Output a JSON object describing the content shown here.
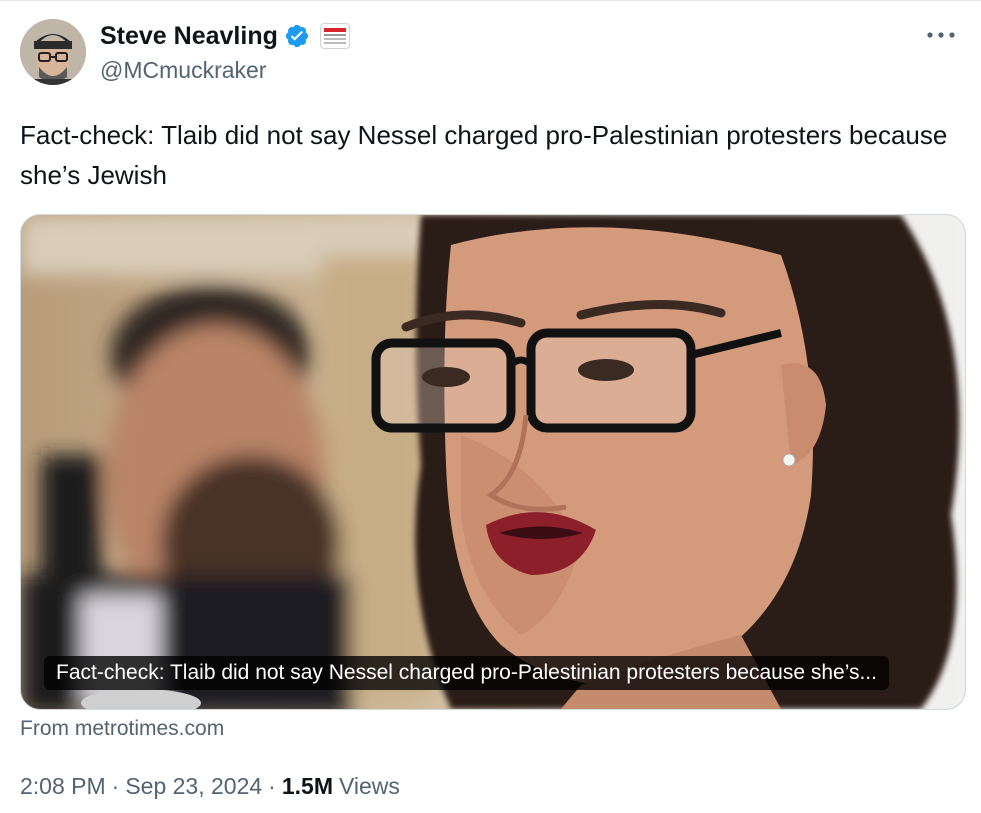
{
  "author": {
    "display_name": "Steve Neavling",
    "handle": "@MCmuckraker",
    "affiliate_badge_text": "METRO TIMES"
  },
  "tweet": {
    "text": "Fact-check: Tlaib did not say Nessel charged pro-Palestinian protesters because she’s Jewish"
  },
  "card": {
    "caption": "Fact-check: Tlaib did not say Nessel charged pro-Palestinian protesters because she’s...",
    "source": "From metrotimes.com"
  },
  "meta": {
    "time": "2:08 PM",
    "date": "Sep 23, 2024",
    "separator": "·",
    "views_count": "1.5M",
    "views_label": "Views"
  },
  "icons": {
    "verified": "verified-badge-icon",
    "more": "more-options-icon"
  },
  "colors": {
    "verified_blue": "#1d9bf0",
    "secondary_text": "#536471",
    "primary_text": "#0f1419",
    "border": "#cfd9de"
  }
}
